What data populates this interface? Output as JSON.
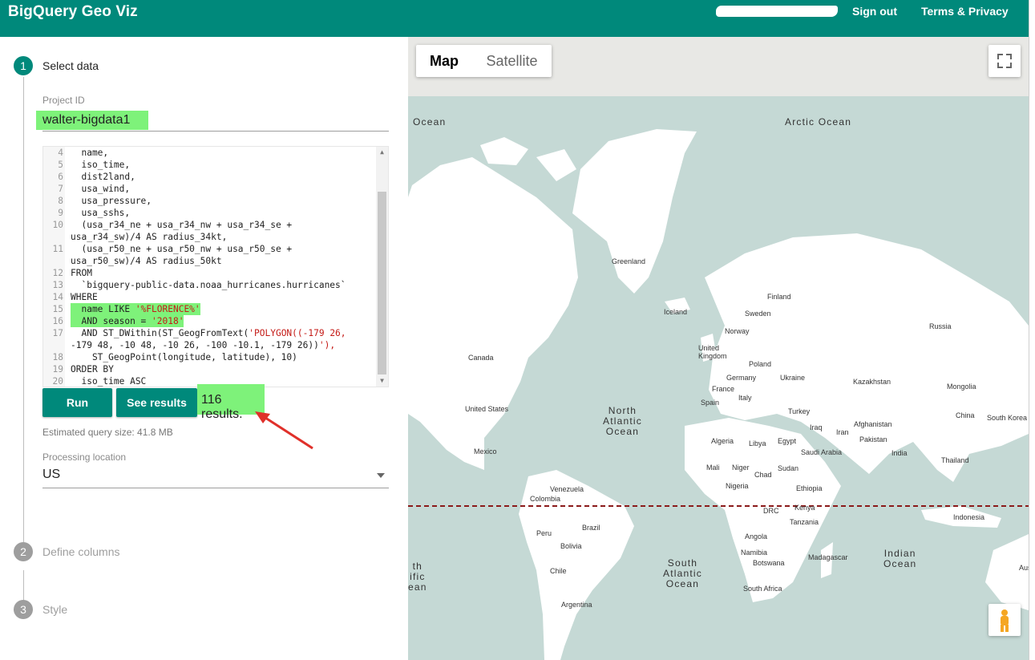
{
  "header": {
    "app_title": "BigQuery Geo Viz",
    "sign_out": "Sign out",
    "terms": "Terms & Privacy"
  },
  "steps": [
    {
      "number": "1",
      "label": "Select data",
      "active": true
    },
    {
      "number": "2",
      "label": "Define columns",
      "active": false
    },
    {
      "number": "3",
      "label": "Style",
      "active": false
    }
  ],
  "project": {
    "label": "Project ID",
    "value": "walter-bigdata1"
  },
  "editor": {
    "lines": [
      {
        "n": "4",
        "text": "  name,"
      },
      {
        "n": "5",
        "text": "  iso_time,"
      },
      {
        "n": "6",
        "text": "  dist2land,"
      },
      {
        "n": "7",
        "text": "  usa_wind,"
      },
      {
        "n": "8",
        "text": "  usa_pressure,"
      },
      {
        "n": "9",
        "text": "  usa_sshs,"
      },
      {
        "n": "10",
        "text": "  (usa_r34_ne + usa_r34_nw + usa_r34_se +"
      },
      {
        "n": "",
        "text": "usa_r34_sw)/4 AS radius_34kt,"
      },
      {
        "n": "11",
        "text": "  (usa_r50_ne + usa_r50_nw + usa_r50_se +"
      },
      {
        "n": "",
        "text": "usa_r50_sw)/4 AS radius_50kt"
      },
      {
        "n": "12",
        "text": "FROM"
      },
      {
        "n": "13",
        "text": "  `bigquery-public-data.noaa_hurricanes.hurricanes`"
      },
      {
        "n": "14",
        "text": "WHERE"
      },
      {
        "n": "15",
        "text": "  name LIKE '%FLORENCE%'"
      },
      {
        "n": "16",
        "text": "  AND season = '2018'"
      },
      {
        "n": "17",
        "text": "  AND ST_DWithin(ST_GeogFromText('POLYGON((-179 26,"
      },
      {
        "n": "",
        "text": "-179 48, -10 48, -10 26, -100 -10.1, -179 26))'),"
      },
      {
        "n": "18",
        "text": "    ST_GeogPoint(longitude, latitude), 10)"
      },
      {
        "n": "19",
        "text": "ORDER BY"
      },
      {
        "n": "20",
        "text": "  iso_time ASC"
      }
    ]
  },
  "actions": {
    "run": "Run",
    "see_results": "See results",
    "results_count": "116 results."
  },
  "query_size": "Estimated query size: 41.8 MB",
  "location": {
    "label": "Processing location",
    "value": "US"
  },
  "map": {
    "type_map": "Map",
    "type_satellite": "Satellite",
    "selected_type": "Map",
    "ocean_labels": [
      {
        "text": "Ocean"
      },
      {
        "text": "Arctic Ocean"
      },
      {
        "text": "North\nAtlantic\nOcean"
      },
      {
        "text": "South\nAtlantic\nOcean"
      },
      {
        "text": "Indian\nOcean"
      },
      {
        "text": "th\nific\nean"
      }
    ],
    "country_labels": [
      "Greenland",
      "Iceland",
      "Finland",
      "Sweden",
      "Norway",
      "Russia",
      "United\nKingdom",
      "Poland",
      "Germany",
      "Ukraine",
      "France",
      "Kazakhstan",
      "Mongolia",
      "Spain",
      "Italy",
      "Turkey",
      "Canada",
      "United States",
      "China",
      "South Korea",
      "Iraq",
      "Iran",
      "Afghanistan",
      "Pakistan",
      "India",
      "Thailand",
      "Mexico",
      "Algeria",
      "Libya",
      "Egypt",
      "Saudi Arabia",
      "Mali",
      "Niger",
      "Chad",
      "Sudan",
      "Nigeria",
      "Ethiopia",
      "Venezuela",
      "Colombia",
      "DRC",
      "Kenya",
      "Tanzania",
      "Peru",
      "Brazil",
      "Bolivia",
      "Angola",
      "Namibia",
      "Botswana",
      "Madagascar",
      "Chile",
      "South Africa",
      "Argentina",
      "Indonesia",
      "Austra"
    ]
  },
  "colors": {
    "primary": "#00897b",
    "highlight": "#7ef27a",
    "water": "#c5d9d5",
    "land": "#ffffff",
    "arrow": "#e0302a",
    "equator": "#8b1a1a"
  }
}
